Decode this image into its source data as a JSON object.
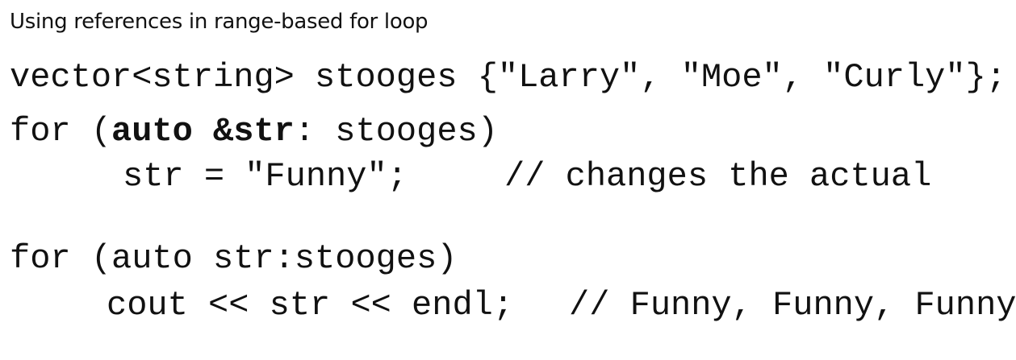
{
  "title": "Using references in range-based for loop",
  "code": {
    "line1": "vector<string> stooges {\"Larry\", \"Moe\", \"Curly\"};",
    "line2_pre": "for (",
    "line2_bold1": "auto &str",
    "line2_mid": ": ",
    "line2_post": "stooges)",
    "line3": "str = \"Funny\";",
    "line3_comment": "// changes the actual",
    "line4": "for (auto str:stooges)",
    "line5": "cout << str << endl;",
    "line5_comment": "// Funny, Funny, Funny"
  }
}
